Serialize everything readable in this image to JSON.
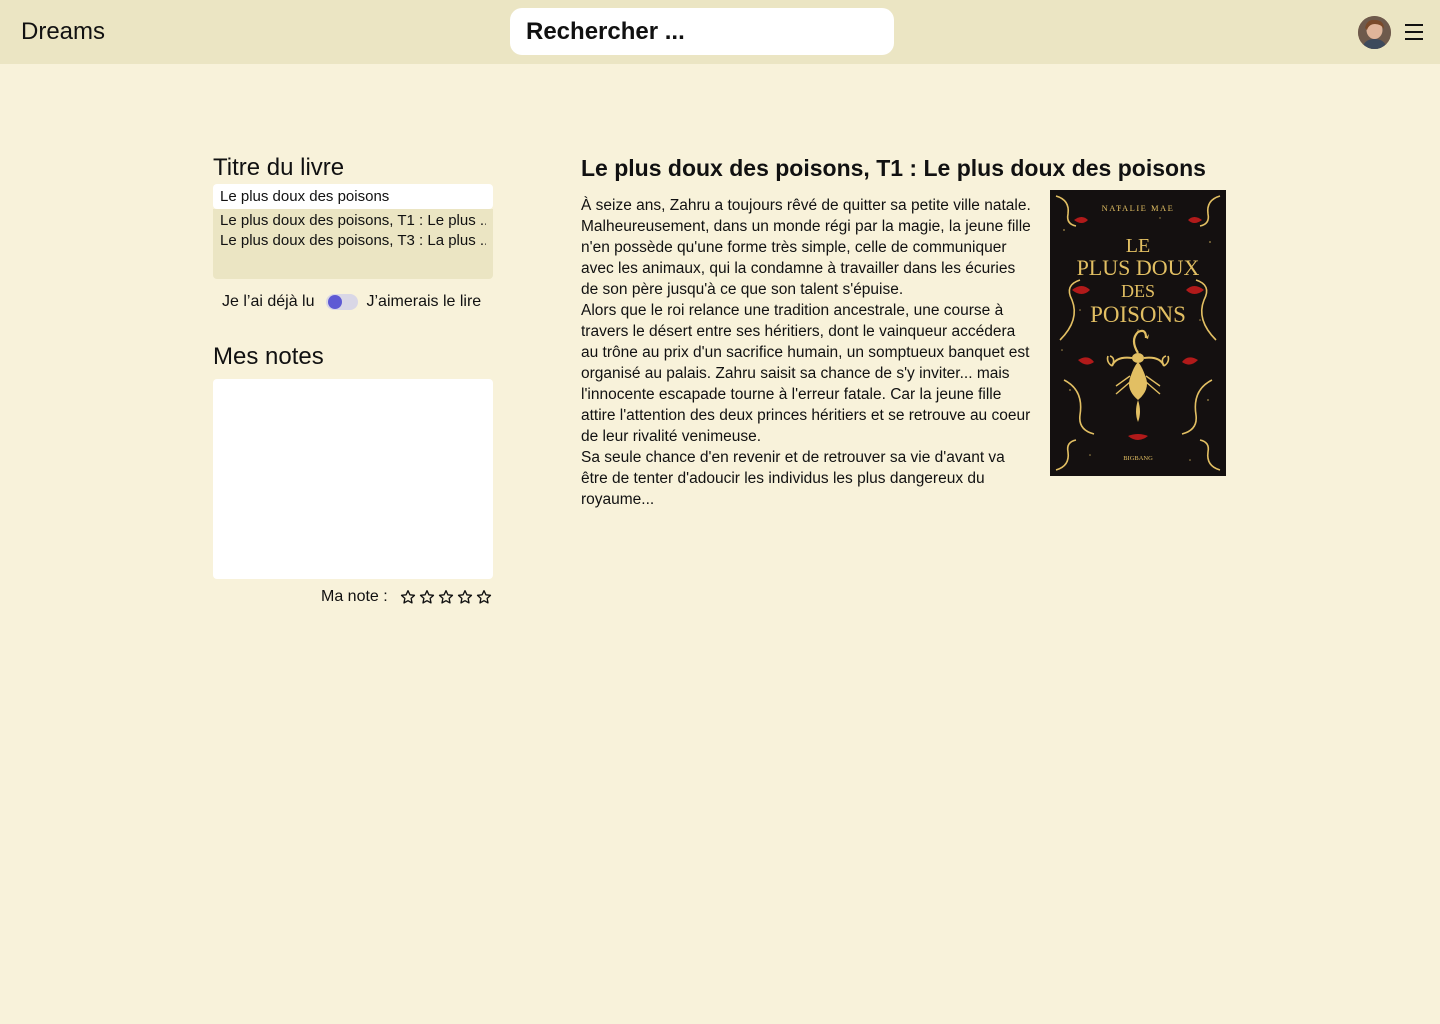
{
  "header": {
    "app_name": "Dreams",
    "search_placeholder": "Rechercher ..."
  },
  "left": {
    "title_label": "Titre du livre",
    "title_value": "Le plus doux des poisons",
    "suggestions": [
      "Le plus doux des poisons, T1 : Le plus ..",
      "Le plus doux des poisons, T3 : La plus .."
    ],
    "toggle_left": "Je l’ai déjà lu",
    "toggle_right": "J’aimerais le lire",
    "notes_label": "Mes notes",
    "rating_label": "Ma note :",
    "rating_value": 0,
    "rating_max": 5
  },
  "book": {
    "heading": "Le plus doux des poisons, T1 : Le plus doux des poisons",
    "description": [
      "À seize ans, Zahru a toujours rêvé de quitter sa petite ville natale.  Malheureusement, dans un monde régi par la magie, la jeune fille n'en  possède qu'une forme très simple, celle de communiquer avec les animaux, qui la condamne à travailler dans les écuries de son père jusqu'à ce  que son talent s'épuise.",
      "Alors que le roi relance une tradition ancestrale, une course à travers le désert entre ses héritiers, dont le vainqueur accédera au  trône au prix d'un sacrifice humain, un somptueux banquet est organisé  au palais. Zahru saisit sa chance de s'y inviter... mais l'innocente  escapade tourne à l'erreur fatale. Car la jeune fille attire l'attention des deux princes héritiers et se retrouve au coeur de leur rivalité venimeuse.",
      "Sa seule chance d'en revenir et de retrouver sa vie d'avant va être  de tenter d'adoucir les individus les plus dangereux du royaume..."
    ],
    "cover": {
      "author": "NATALIE MAE",
      "title_line1": "LE",
      "title_line2": "PLUS DOUX",
      "title_line3": "DES",
      "title_line4": "POISONS",
      "publisher": "BIGBANG"
    }
  },
  "colors": {
    "background": "#f8f2da",
    "header": "#ebe5c3",
    "toggle_knob": "#5e5ad4",
    "cover_bg": "#141010",
    "cover_gold": "#e2bf63",
    "cover_red": "#b11a1a"
  }
}
